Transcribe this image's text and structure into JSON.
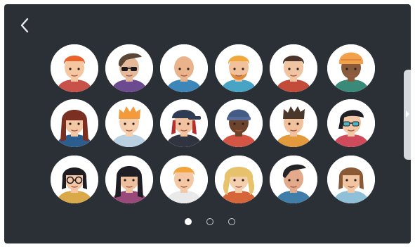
{
  "screen": {
    "back_icon": "chevron-left-icon",
    "next_icon": "caret-right-icon"
  },
  "avatars": [
    {
      "name": "avatar-redhead-man",
      "skin": "#f4c7a1",
      "hair": "#e8622a",
      "style": "short",
      "shirt": "#c8524a",
      "glasses": false,
      "beard": false
    },
    {
      "name": "avatar-sunglasses-man",
      "skin": "#e6b99a",
      "hair": "#5a4636",
      "style": "swoop",
      "shirt": "#6b4a8f",
      "glasses": "dark",
      "beard": false
    },
    {
      "name": "avatar-bald-man",
      "skin": "#e9b48c",
      "hair": "#e9b48c",
      "style": "bald",
      "shirt": "#3d86b8",
      "glasses": false,
      "beard": false
    },
    {
      "name": "avatar-blond-bearded-man",
      "skin": "#f1c19b",
      "hair": "#f0a83a",
      "style": "short",
      "shirt": "#48a4c4",
      "glasses": false,
      "beard": "#e2893a"
    },
    {
      "name": "avatar-dark-haired-man",
      "skin": "#f0c4a0",
      "hair": "#4a3429",
      "style": "short",
      "shirt": "#c24b3a",
      "glasses": false,
      "beard": false
    },
    {
      "name": "avatar-orange-headwrap-man",
      "skin": "#8a5a3c",
      "hair": "#f2a14a",
      "style": "wrap",
      "shirt": "#3a8a7a",
      "glasses": false,
      "beard": false
    },
    {
      "name": "avatar-ponytail-woman",
      "skin": "#f3c6a4",
      "hair": "#7a2f22",
      "style": "long",
      "shirt": "#2c5d8f",
      "glasses": false,
      "beard": false
    },
    {
      "name": "avatar-ginger-boy",
      "skin": "#f5cfad",
      "hair": "#f29a3c",
      "style": "spiky",
      "shirt": "#b9d0e0",
      "glasses": false,
      "beard": false
    },
    {
      "name": "avatar-cap-girl",
      "skin": "#f2c2a0",
      "hair": "#b5302c",
      "style": "cap",
      "shirt": "#2f3440",
      "glasses": false,
      "beard": false
    },
    {
      "name": "avatar-beanie-man",
      "skin": "#6d442b",
      "hair": "#445b86",
      "style": "beanie",
      "shirt": "#d55545",
      "glasses": false,
      "beard": false
    },
    {
      "name": "avatar-messy-hair-man",
      "skin": "#f1c19c",
      "hair": "#4a372c",
      "style": "spiky",
      "shirt": "#e39a3c",
      "glasses": false,
      "beard": false
    },
    {
      "name": "avatar-shades-woman",
      "skin": "#f3c7a6",
      "hair": "#1f1f25",
      "style": "side",
      "shirt": "#cf4a5a",
      "glasses": "teal",
      "beard": false
    },
    {
      "name": "avatar-glasses-woman",
      "skin": "#f3c7a6",
      "hair": "#1d1d22",
      "style": "bob",
      "shirt": "#d9a94a",
      "glasses": "clear",
      "beard": false
    },
    {
      "name": "avatar-earrings-woman",
      "skin": "#efc09e",
      "hair": "#1e1e24",
      "style": "long",
      "shirt": "#9a4a7a",
      "glasses": false,
      "beard": false
    },
    {
      "name": "avatar-blond-young-man",
      "skin": "#f4c8a4",
      "hair": "#f2a33c",
      "style": "short",
      "shirt": "#e9e9ea",
      "glasses": false,
      "beard": false
    },
    {
      "name": "avatar-curly-blonde-woman",
      "skin": "#f4cfae",
      "hair": "#e7c26c",
      "style": "curly",
      "shirt": "#d6663a",
      "glasses": false,
      "beard": false
    },
    {
      "name": "avatar-side-swept-man",
      "skin": "#e2a98a",
      "hair": "#242428",
      "style": "swoop",
      "shirt": "#3f7ea8",
      "glasses": false,
      "beard": false
    },
    {
      "name": "avatar-bob-hair-woman",
      "skin": "#f1c4a2",
      "hair": "#8a5a36",
      "style": "bob",
      "shirt": "#8fc0d8",
      "glasses": false,
      "beard": false
    }
  ],
  "pagination": {
    "pages": 3,
    "current": 1
  }
}
